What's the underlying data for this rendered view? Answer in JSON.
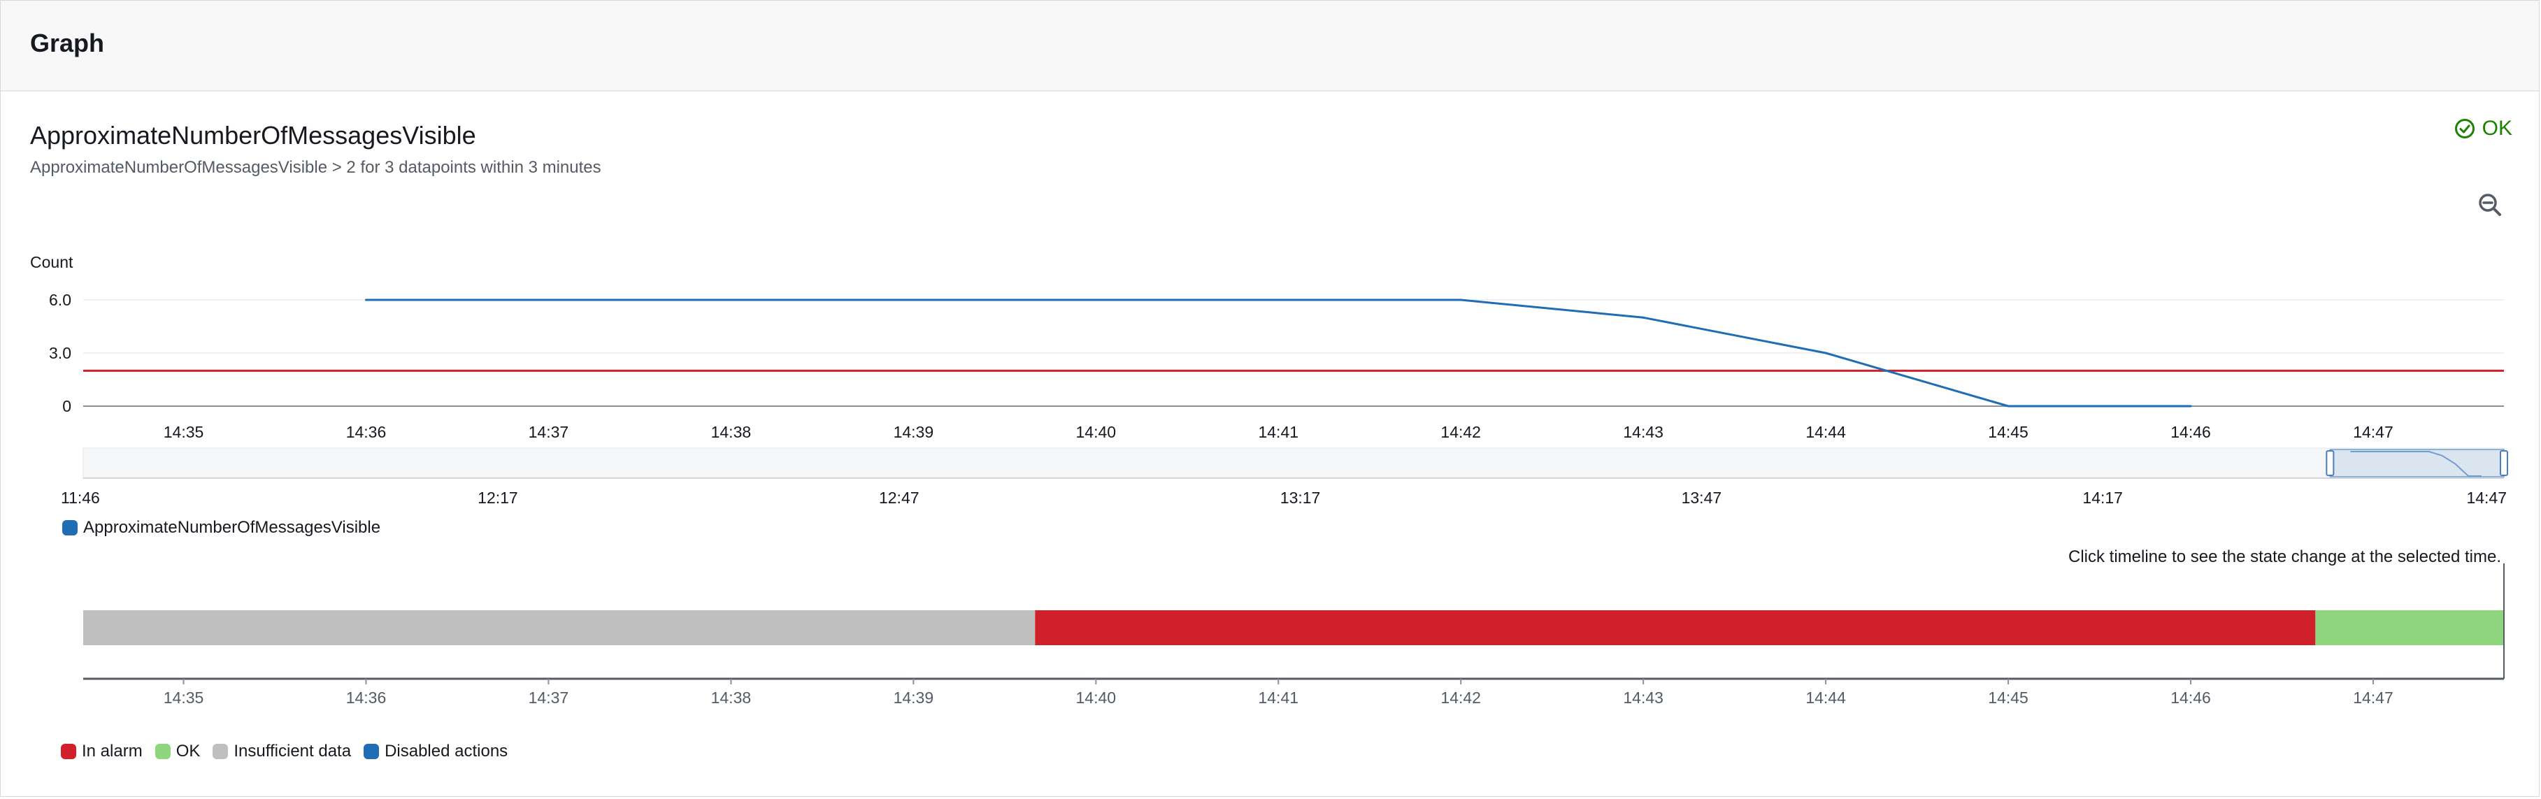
{
  "panel": {
    "title": "Graph"
  },
  "metric": {
    "title": "ApproximateNumberOfMessagesVisible",
    "subtitle": "ApproximateNumberOfMessagesVisible > 2 for 3 datapoints within 3 minutes",
    "status": "OK"
  },
  "icons": {
    "status": "check-circle-icon",
    "zoom": "zoom-out-icon"
  },
  "colors": {
    "series": "#1f6db5",
    "threshold": "#d0212b",
    "in_alarm": "#d0212b",
    "ok": "#8ed57e",
    "insufficient": "#bfbfbf",
    "disabled": "#1f6db5",
    "status_ok": "#1d8102"
  },
  "chart_data": [
    {
      "type": "line",
      "ylabel": "Count",
      "ylim": [
        0,
        6
      ],
      "yticks": [
        {
          "value": 0,
          "label": "0"
        },
        {
          "value": 3,
          "label": "3.0"
        },
        {
          "value": 6,
          "label": "6.0"
        }
      ],
      "x_tick_labels": [
        "14:35",
        "14:36",
        "14:37",
        "14:38",
        "14:39",
        "14:40",
        "14:41",
        "14:42",
        "14:43",
        "14:44",
        "14:45",
        "14:46",
        "14:47"
      ],
      "x_range": [
        "14:34:27",
        "14:47:43"
      ],
      "grid": true,
      "threshold": 2,
      "series": [
        {
          "name": "ApproximateNumberOfMessagesVisible",
          "x": [
            "14:36",
            "14:42",
            "14:43",
            "14:44",
            "14:45",
            "14:46"
          ],
          "values": [
            6,
            6,
            5,
            3,
            0,
            0
          ]
        }
      ]
    },
    {
      "type": "timeline-navigator",
      "x_tick_labels": [
        "11:46",
        "12:17",
        "12:47",
        "13:17",
        "13:47",
        "14:17",
        "14:47"
      ],
      "x_range": [
        "11:46",
        "14:47"
      ],
      "selection": [
        "14:34",
        "14:47"
      ]
    },
    {
      "type": "state-timeline",
      "hint": "Click timeline to see the state change at the selected time.",
      "x_tick_labels": [
        "14:35",
        "14:36",
        "14:37",
        "14:38",
        "14:39",
        "14:40",
        "14:41",
        "14:42",
        "14:43",
        "14:44",
        "14:45",
        "14:46",
        "14:47"
      ],
      "x_range": [
        "14:34:27",
        "14:47:43"
      ],
      "segments": [
        {
          "state": "Insufficient data",
          "start": "14:34:27",
          "end": "14:39:40"
        },
        {
          "state": "In alarm",
          "start": "14:39:40",
          "end": "14:46:41"
        },
        {
          "state": "OK",
          "start": "14:46:41",
          "end": "14:47:43"
        }
      ]
    }
  ],
  "legend_series": [
    {
      "label": "ApproximateNumberOfMessagesVisible",
      "color": "#1f6db5"
    }
  ],
  "legend_states": [
    {
      "label": "In alarm",
      "color": "#d0212b"
    },
    {
      "label": "OK",
      "color": "#8ed57e"
    },
    {
      "label": "Insufficient data",
      "color": "#bfbfbf"
    },
    {
      "label": "Disabled actions",
      "color": "#1f6db5"
    }
  ]
}
